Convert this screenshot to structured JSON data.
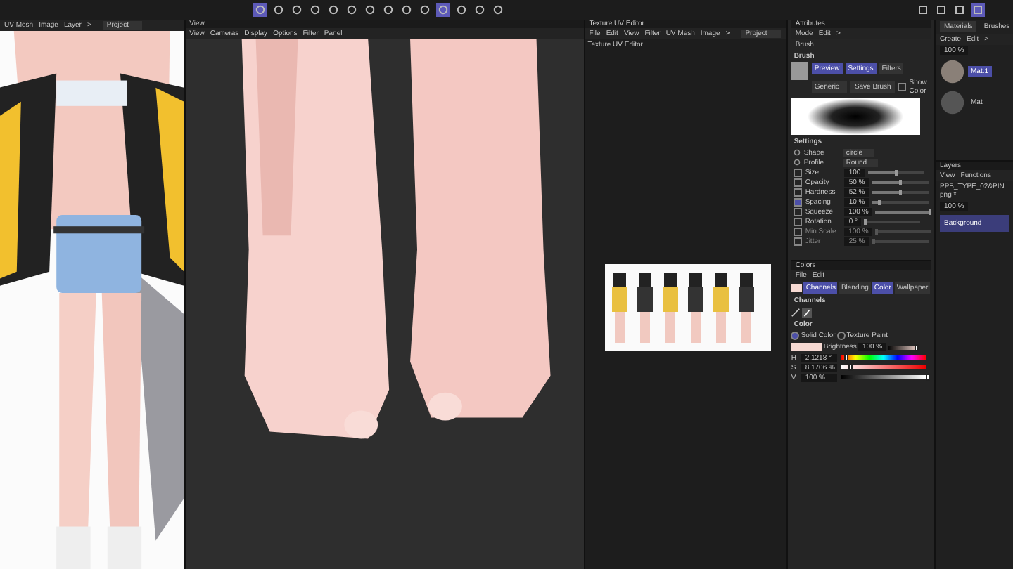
{
  "left_panel": {
    "menu": [
      "UV Mesh",
      "Image",
      "Layer",
      ">"
    ],
    "dropdown": "Project"
  },
  "viewport": {
    "title": "View",
    "menu": [
      "View",
      "Cameras",
      "Display",
      "Options",
      "Filter",
      "Panel"
    ]
  },
  "uv_editor": {
    "title": "Texture UV Editor",
    "menu": [
      "File",
      "Edit",
      "View",
      "Filter",
      "UV Mesh",
      "Image",
      ">"
    ],
    "dropdown": "Project",
    "label": "Texture UV Editor"
  },
  "attributes": {
    "title": "Attributes",
    "menu": [
      "Mode",
      "Edit",
      ">"
    ],
    "object": "Brush",
    "section": "Brush",
    "tabs": [
      {
        "label": "Preview",
        "selected": true
      },
      {
        "label": "Settings",
        "selected": true
      },
      {
        "label": "Filters",
        "selected": false
      }
    ],
    "preset": "Generic",
    "save_button": "Save Brush",
    "show_color": {
      "label": "Show Color",
      "checked": false
    },
    "settings_title": "Settings",
    "settings": [
      {
        "kind": "dropdown",
        "name": "Shape",
        "value": "circle"
      },
      {
        "kind": "dropdown",
        "name": "Profile",
        "value": "Round"
      },
      {
        "kind": "slider",
        "name": "Size",
        "value": "100",
        "level": 0.5,
        "checked": false,
        "disabled": false
      },
      {
        "kind": "slider",
        "name": "Opacity",
        "value": "50 %",
        "level": 0.5,
        "checked": false,
        "disabled": false
      },
      {
        "kind": "slider",
        "name": "Hardness",
        "value": "52 %",
        "level": 0.52,
        "checked": false,
        "disabled": false
      },
      {
        "kind": "slider",
        "name": "Spacing",
        "value": "10 %",
        "level": 0.1,
        "checked": true,
        "disabled": false
      },
      {
        "kind": "slider",
        "name": "Squeeze",
        "value": "100 %",
        "level": 1,
        "checked": false,
        "disabled": false
      },
      {
        "kind": "slider",
        "name": "Rotation",
        "value": "0 °",
        "level": 0,
        "checked": false,
        "disabled": false
      },
      {
        "kind": "slider",
        "name": "Min Scale",
        "value": "100 %",
        "level": 0,
        "checked": false,
        "disabled": true
      },
      {
        "kind": "slider",
        "name": "Jitter",
        "value": "25 %",
        "level": 0,
        "checked": false,
        "disabled": true
      }
    ]
  },
  "colors": {
    "title": "Colors",
    "menu": [
      "File",
      "Edit"
    ],
    "tabs": [
      {
        "label": "Channels",
        "selected": true
      },
      {
        "label": "Blending",
        "selected": false
      },
      {
        "label": "Color",
        "selected": true
      },
      {
        "label": "Wallpaper",
        "selected": false
      }
    ],
    "channels_title": "Channels",
    "color_title": "Color",
    "modes": [
      {
        "label": "Solid Color",
        "selected": true
      },
      {
        "label": "Texture Paint",
        "selected": false
      }
    ],
    "brightness_label": "Brightness",
    "brightness": "100 %",
    "brightness_slider": {
      "level": 1
    },
    "hsv": [
      {
        "name": "H",
        "value": "2.1218 °",
        "level": 0.02
      },
      {
        "name": "S",
        "value": "8.1706 %",
        "level": 0.08
      },
      {
        "name": "V",
        "value": "100 %",
        "level": 1
      }
    ]
  },
  "materials": {
    "tabs": [
      {
        "label": "Materials",
        "selected": true
      },
      {
        "label": "Brushes",
        "selected": false
      }
    ],
    "menu": [
      "Create",
      "Edit",
      ">"
    ],
    "zoom": "100 %",
    "items": [
      {
        "name": "Mat.1",
        "selected": true
      },
      {
        "name": "Mat",
        "selected": false
      }
    ]
  },
  "layers": {
    "title": "Layers",
    "menu": [
      "View",
      "Functions"
    ],
    "file": "PPB_TYPE_02&PIN.png *",
    "opacity": "100 %",
    "items": [
      {
        "name": "Background",
        "selected": true
      }
    ]
  }
}
